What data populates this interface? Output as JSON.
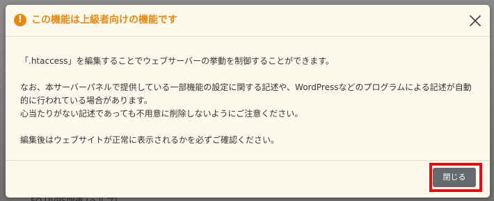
{
  "background": {
    "partial_text": "FO.UVPS関連 (ヘルプ)"
  },
  "dialog": {
    "title": "この機能は上級者向けの機能です",
    "title_color": "#e8880f",
    "warning_icon": "exclamation-circle-icon",
    "warning_icon_glyph": "!",
    "close_icon": "close-icon",
    "body": {
      "line1": "「.htaccess」を編集することでウェブサーバーの挙動を制御することができます。",
      "line2a": "なお、本サーバーパネルで提供している一部機能の設定に関する記述や、WordPressなどのプログラムによる記述が自動",
      "line2b": "的に行われている場合があります。",
      "line3": "心当たりがない記述であっても不用意に削除しないようにご注意ください。",
      "line4": "編集後はウェブサイトが正常に表示されるかを必ずご確認ください。"
    },
    "close_button_label": "閉じる",
    "highlight_color": "#e01010"
  }
}
